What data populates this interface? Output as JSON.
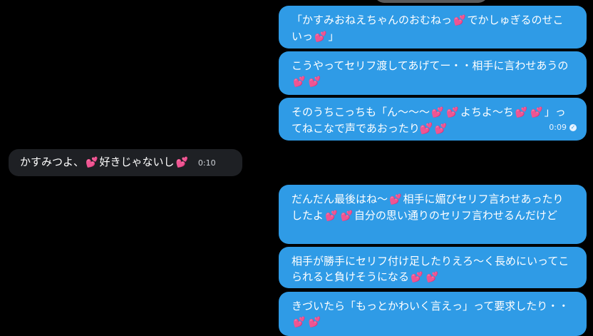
{
  "messages": [
    {
      "side": "out",
      "parts": [
        "「かすみおねえちゃんのおむねっ",
        "💕",
        "でかしゅぎるのせこいっ",
        "💕",
        "」"
      ]
    },
    {
      "side": "out",
      "parts": [
        "こうやってセリフ渡してあげてー・・相手に言わせあうの",
        "💕",
        "💕"
      ]
    },
    {
      "side": "out",
      "parts": [
        "そのうちこっちも「ん〜〜〜",
        "💕",
        "💕",
        "よちよ〜ち",
        "💕",
        "💕",
        "」ってねこなで声であおったり",
        "💕",
        "💕"
      ],
      "time": "0:09",
      "read": true
    },
    {
      "side": "in",
      "parts": [
        "かすみつよ、",
        "💕",
        "好きじゃないし",
        "💕"
      ],
      "time": "0:10"
    },
    {
      "side": "out",
      "parts": [
        "だんだん最後はね〜",
        "💕",
        "相手に媚びセリフ言わせあったりしたよ",
        "💕",
        "💕",
        "自分の思い通りのセリフ言わせるんだけど"
      ]
    },
    {
      "side": "out",
      "parts": [
        "相手が勝手にセリフ付け足したりえろ〜く長めにいってこられると負けそうになる",
        "💕",
        "💕"
      ]
    },
    {
      "side": "out",
      "parts": [
        "きづいたら「もっとかわいく言えっ」って要求したり・・",
        "💕",
        "💕"
      ]
    }
  ],
  "icons": {
    "heart": "two-hearts-icon",
    "read": "check-circle-icon"
  },
  "colors": {
    "outgoing": "#2f9be6",
    "incoming": "#1e2024",
    "heart": "#ff4f8e",
    "background": "#000000"
  }
}
